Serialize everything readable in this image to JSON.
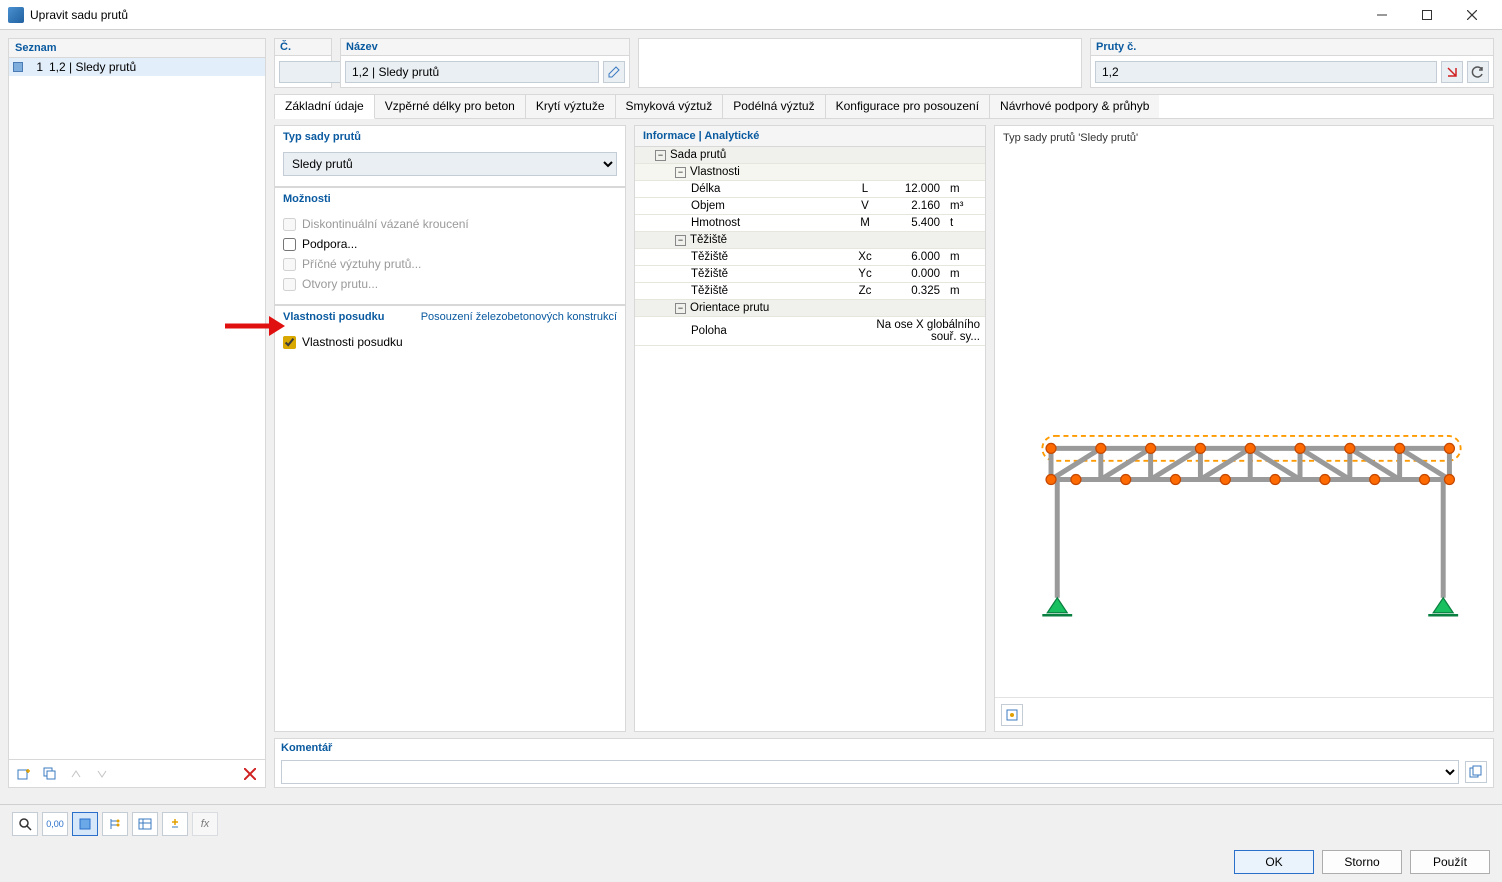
{
  "window": {
    "title": "Upravit sadu prutů",
    "number_header": "Č.",
    "name_header": "Název",
    "members_header": "Pruty č.",
    "number_value": "1",
    "name_value": "1,2 | Sledy prutů",
    "members_value": "1,2"
  },
  "list_panel": {
    "header": "Seznam",
    "items": [
      {
        "num": "1",
        "label": "1,2 | Sledy prutů"
      }
    ]
  },
  "tabs": [
    "Základní údaje",
    "Vzpěrné délky pro beton",
    "Krytí výztuže",
    "Smyková výztuž",
    "Podélná výztuž",
    "Konfigurace pro posouzení",
    "Návrhové podpory & průhyb"
  ],
  "type_group": {
    "title": "Typ sady prutů",
    "selected": "Sledy prutů"
  },
  "options_group": {
    "title": "Možnosti",
    "items": [
      {
        "label": "Diskontinuální vázané kroucení",
        "enabled": false,
        "checked": false
      },
      {
        "label": "Podpora",
        "enabled": true,
        "checked": false,
        "dotted": true
      },
      {
        "label": "Příčné výztuhy prutů",
        "enabled": false,
        "checked": false,
        "dotted": true
      },
      {
        "label": "Otvory prutu",
        "enabled": false,
        "checked": false,
        "dotted": true
      }
    ]
  },
  "design_group": {
    "title": "Vlastnosti posudku",
    "link": "Posouzení železobetonových konstrukcí",
    "check_label": "Vlastnosti posudku"
  },
  "info_panel": {
    "header": "Informace | Analytické",
    "sections": [
      {
        "title": "Sada prutů",
        "children": [
          {
            "title": "Vlastnosti",
            "rows": [
              {
                "label": "Délka",
                "sym": "L",
                "val": "12.000",
                "unit": "m"
              },
              {
                "label": "Objem",
                "sym": "V",
                "val": "2.160",
                "unit": "m³"
              },
              {
                "label": "Hmotnost",
                "sym": "M",
                "val": "5.400",
                "unit": "t"
              }
            ]
          }
        ]
      },
      {
        "title": "Těžiště",
        "rows": [
          {
            "label": "Těžiště",
            "sym": "Xc",
            "val": "6.000",
            "unit": "m"
          },
          {
            "label": "Těžiště",
            "sym": "Yc",
            "val": "0.000",
            "unit": "m"
          },
          {
            "label": "Těžiště",
            "sym": "Zc",
            "val": "0.325",
            "unit": "m"
          }
        ]
      },
      {
        "title": "Orientace prutu",
        "rows": [
          {
            "label": "Poloha",
            "sym": "",
            "val_text": "Na ose X globálního souř. sy..."
          }
        ]
      }
    ]
  },
  "viz": {
    "title": "Typ sady prutů 'Sledy prutů'"
  },
  "comment": {
    "header": "Komentář"
  },
  "buttons": {
    "ok": "OK",
    "cancel": "Storno",
    "apply": "Použít"
  }
}
